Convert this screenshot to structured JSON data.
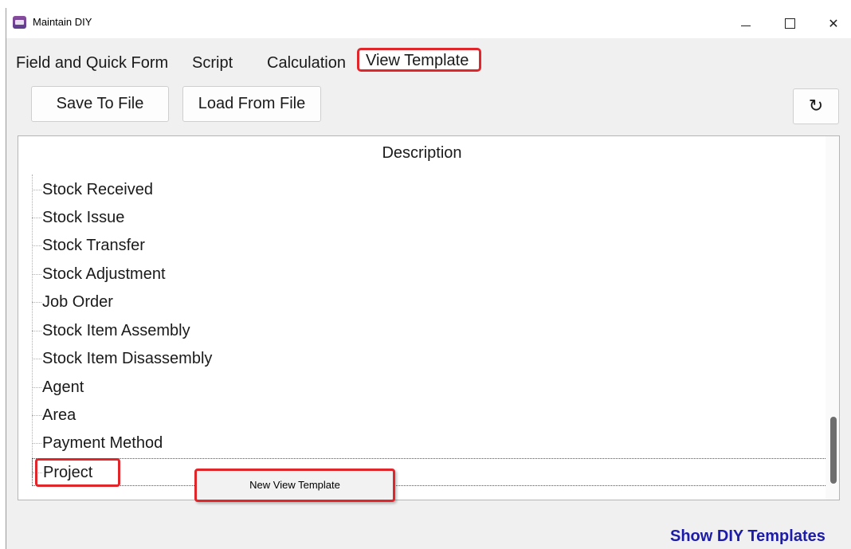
{
  "window": {
    "title": "Maintain DIY"
  },
  "tabs": [
    {
      "label": "Field and Quick Form"
    },
    {
      "label": "Script"
    },
    {
      "label": "Calculation"
    },
    {
      "label": "View Template"
    }
  ],
  "toolbar": {
    "save_label": "Save To File",
    "load_label": "Load From File",
    "refresh_icon": "↻"
  },
  "list": {
    "header": "Description",
    "items": [
      "Stock Received",
      "Stock Issue",
      "Stock Transfer",
      "Stock Adjustment",
      "Job Order",
      "Stock Item Assembly",
      "Stock Item Disassembly",
      "Agent",
      "Area",
      "Payment Method",
      "Project"
    ],
    "selected": "Project"
  },
  "context_menu": {
    "items": [
      "New View Template"
    ]
  },
  "footer": {
    "link_label": "Show DIY Templates"
  },
  "colors": {
    "highlight": "#e0262b",
    "link": "#1c1ca8"
  }
}
